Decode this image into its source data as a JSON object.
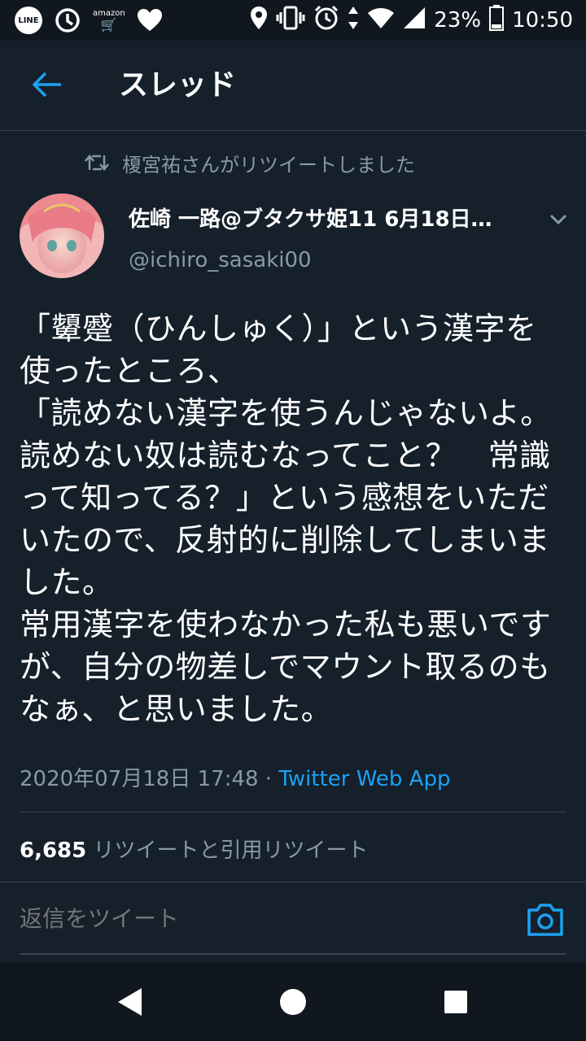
{
  "status_bar": {
    "line_label": "LINE",
    "amazon_label": "amazon",
    "battery": "23%",
    "time": "10:50"
  },
  "header": {
    "title": "スレッド"
  },
  "retweet": {
    "label": "榎宮祐さんがリツイートしました"
  },
  "tweet": {
    "author_name": "佐崎 一路@ブタクサ姫11 6月18日…",
    "author_handle": "@ichiro_sasaki00",
    "text": "「顰蹙（ひんしゅく）」という漢字を使ったところ、\n「読めない漢字を使うんじゃないよ。読めない奴は読むなってこと？　常識って知ってる？」という感想をいただいたので、反射的に削除してしまいました。\n常用漢字を使わなかった私も悪いですが、自分の物差しでマウント取るのもなぁ、と思いました。",
    "timestamp": "2020年07月18日 17:48",
    "separator": " · ",
    "app": "Twitter Web App"
  },
  "stats": {
    "count": "6,685",
    "label": " リツイートと引用リツイート"
  },
  "reply": {
    "placeholder": "返信をツイート"
  },
  "colors": {
    "background": "#15202b",
    "accent": "#1da1f2",
    "secondary_text": "#8899a6",
    "divider": "#38444d"
  }
}
